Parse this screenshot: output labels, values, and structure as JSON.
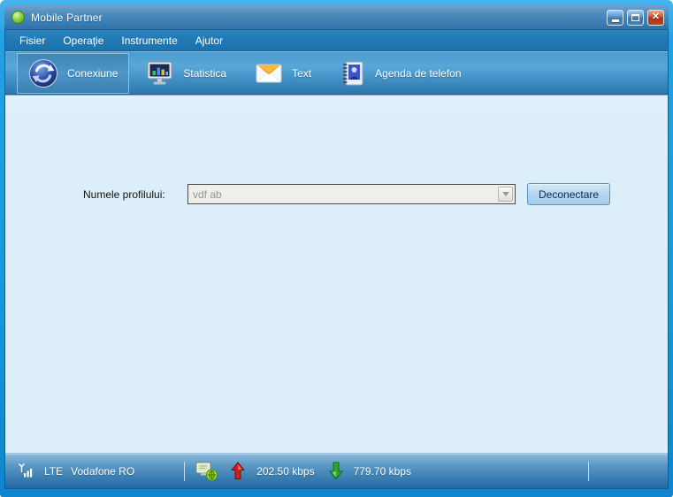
{
  "window": {
    "title": "Mobile Partner"
  },
  "menu": {
    "items": [
      {
        "label": "Fisier"
      },
      {
        "label": "Operaţie"
      },
      {
        "label": "Instrumente"
      },
      {
        "label": "Ajutor"
      }
    ]
  },
  "toolbar": {
    "items": [
      {
        "label": "Conexiune",
        "icon": "sync-connection-icon",
        "selected": true
      },
      {
        "label": "Statistica",
        "icon": "statistics-monitor-icon",
        "selected": false
      },
      {
        "label": "Text",
        "icon": "envelope-icon",
        "selected": false
      },
      {
        "label": "Agenda de telefon",
        "icon": "phonebook-icon",
        "selected": false
      }
    ]
  },
  "connection_panel": {
    "profile_label": "Numele profilului:",
    "profile_value": "vdf ab",
    "profile_dropdown_disabled": true,
    "disconnect_button": "Deconectare"
  },
  "statusbar": {
    "network_type": "LTE",
    "operator": "Vodafone RO",
    "upload_speed": "202.50 kbps",
    "download_speed": "779.70 kbps",
    "icons": [
      "signal-strength-icon",
      "network-connected-pc-icon",
      "upload-arrow-icon",
      "download-arrow-icon"
    ]
  },
  "colors": {
    "frame_blue": "#189ADE",
    "titlebar_blue": "#4A89BB",
    "menubar_blue": "#1F78B2",
    "toolbar_blue": "#4190C6",
    "content_bg": "#DCEEFA",
    "statusbar_blue": "#3A7FB2",
    "close_button_red": "#C23A20",
    "disconnect_button_bg": "#B4D7F0",
    "upload_arrow_red": "#CE1F1F",
    "download_arrow_green": "#2EA62E",
    "app_orb_green": "#8ED23E"
  }
}
